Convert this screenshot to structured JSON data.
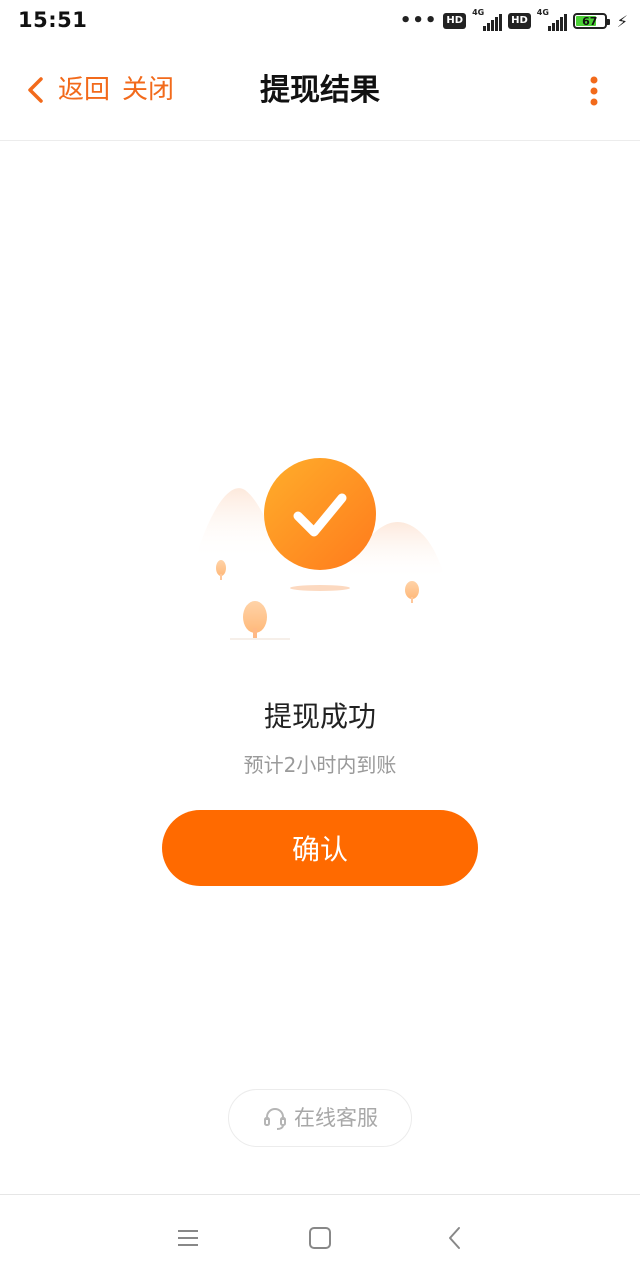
{
  "status_bar": {
    "time": "15:51",
    "more": "•••",
    "hd1": "HD",
    "net1": "4G",
    "hd2": "HD",
    "net2": "4G",
    "battery": "67"
  },
  "navbar": {
    "back_label": "返回",
    "close_label": "关闭",
    "title": "提现结果"
  },
  "result": {
    "title": "提现成功",
    "subtitle": "预计2小时内到账",
    "confirm_label": "确认"
  },
  "support": {
    "label": "在线客服"
  },
  "colors": {
    "accent": "#ff6a00",
    "nav_accent": "#f26a1b",
    "battery_fill": "#4cd137"
  },
  "icons": {
    "back": "chevron-left-icon",
    "more": "more-vertical-icon",
    "success": "check-circle-icon",
    "support": "headset-icon",
    "sys_menu": "menu-icon",
    "sys_home": "home-square-icon",
    "sys_back": "back-triangle-icon"
  }
}
